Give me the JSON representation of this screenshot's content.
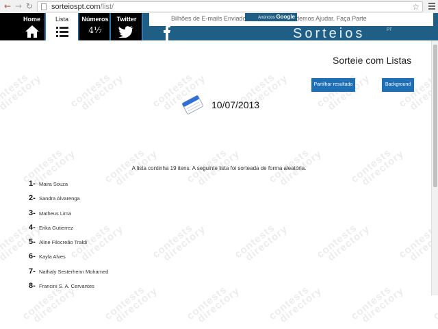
{
  "browser": {
    "url_host": "sorteiospt.com",
    "url_path": "/list/"
  },
  "nav": {
    "tabs": [
      {
        "label": "Home",
        "icon": "home-icon"
      },
      {
        "label": "Lista",
        "icon": "list-icon"
      },
      {
        "label": "Números",
        "icon": "fraction-icon",
        "glyph": "4¹⁄₇"
      },
      {
        "label": "Twitter",
        "icon": "twitter-bird-icon"
      }
    ],
    "facebook_icon": "facebook-icon"
  },
  "ad": {
    "text": "Bilhões de E-mails Enviados. Saiba Como Podemos Ajudar. Faça Parte",
    "ads_by": "Anúncios",
    "ads_brand": "Google"
  },
  "brand": {
    "name": "Sorteios",
    "suffix": "PT"
  },
  "page": {
    "title": "Sorteie com Listas",
    "share_button": "Partilhar resultado",
    "background_button": "Background",
    "date": "10/07/2013",
    "info": "A lista continha 19 itens. A seguinte lista foi sorteada de forma aleatória."
  },
  "results": [
    {
      "num": "1-",
      "name": "Maira Souza"
    },
    {
      "num": "2-",
      "name": "Sandra Alvarenga"
    },
    {
      "num": "3-",
      "name": "Matheus Lima"
    },
    {
      "num": "4-",
      "name": "Erika Gutierrez"
    },
    {
      "num": "5-",
      "name": "Aline Filocreão Traldi"
    },
    {
      "num": "6-",
      "name": "Kayla Alves"
    },
    {
      "num": "7-",
      "name": "Nathaly Sesterhenn Mohamed"
    },
    {
      "num": "8-",
      "name": "Francini S. A. Cervantes"
    }
  ],
  "watermark": {
    "line1": "contests",
    "line2": "directory"
  },
  "colors": {
    "header": "#1f5f86",
    "button": "#1f6fb5",
    "tab_dark": "#000000"
  }
}
